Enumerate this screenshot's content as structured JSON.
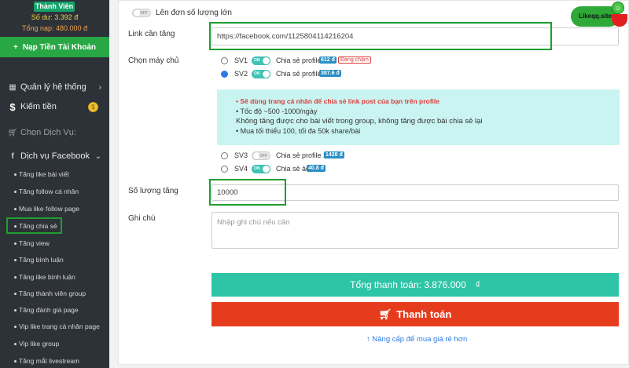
{
  "account": {
    "badge": "Thành Viên",
    "balance": "Số dư: 3.392 đ",
    "total_deposit": "Tổng nạp: 480.000 đ",
    "deposit_button": "Nạp Tiền Tài Khoản"
  },
  "sidebar": {
    "system": "Quản lý hệ thống",
    "earn": "Kiếm tiền",
    "select_service": "Chọn Dịch Vụ:",
    "facebook_service": "Dịch vụ Facebook",
    "items": [
      "Tăng like bài viết",
      "Tăng follow cá nhân",
      "Mua like follow page",
      "Tăng chia sẻ",
      "Tăng view",
      "Tăng bình luận",
      "Tăng like bình luận",
      "Tăng thành viên group",
      "Tăng đánh giá page",
      "Vip like trang cá nhân page",
      "Vip like group",
      "Tăng mắt livestream"
    ]
  },
  "logo": {
    "text": "Likeqq.site"
  },
  "form": {
    "bulk_order_label": "Lên đơn số lượng lớn",
    "toggle_off": "OFF",
    "toggle_on": "ON",
    "link_label": "Link cần tăng",
    "link_value": "https://facebook.com/1125804114216204",
    "server_label": "Chọn máy chủ",
    "servers": [
      {
        "code": "SV1",
        "name": "Chia sẻ profile",
        "price": "612 đ",
        "note": "Đang chậm",
        "toggle": "ON"
      },
      {
        "code": "SV2",
        "name": "Chia sẻ profile",
        "price": "387.6 đ",
        "toggle": "ON"
      },
      {
        "code": "SV3",
        "name": "Chia sẻ profile 2",
        "price": "1428 đ",
        "toggle": "OFF"
      },
      {
        "code": "SV4",
        "name": "Chia sẻ ảo",
        "price": "40.8 đ",
        "toggle": "ON"
      }
    ],
    "info": {
      "warning": "Sẽ dùng trang cá nhân để chia sẻ link post của bạn trên profile",
      "speed": "Tốc độ ~500 -1000/ngày",
      "restriction": "Không tăng được cho bài viết trong group, không tăng được bài chia sẻ lại",
      "limits": "Mua tối thiểu 100, tối đa 50k share/bài"
    },
    "quantity_label": "Số lượng tăng",
    "quantity_value": "10000",
    "note_label": "Ghi chú",
    "note_placeholder": "Nhập ghi chú nếu cần",
    "total_text": "Tổng thanh toán: 3.876.000",
    "currency": "₫",
    "pay_button": "Thanh toán",
    "upgrade_link": "Nâng cấp để mua giá rẻ hơn"
  },
  "colors": {
    "sidebar_bg": "#2d3238",
    "deposit_green": "#28a745",
    "total_teal": "#2ec4a6",
    "pay_red": "#e63c1e",
    "info_bg": "#c9f4f1",
    "highlight_green": "#1e9e2e"
  }
}
